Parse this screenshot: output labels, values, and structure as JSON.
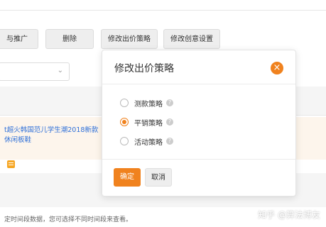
{
  "toolbar": {
    "promote_label": "与推广",
    "delete_label": "删除",
    "bid_strategy_label": "修改出价策略",
    "creative_label": "修改创意设置"
  },
  "table": {
    "product_title_line1": "t超火韩国范儿学生潮2018新款",
    "product_title_line2": "休闲板鞋",
    "footer_note": "定时间段数据，您可选择不同时间段来查看。"
  },
  "modal": {
    "title": "修改出价策略",
    "options": [
      {
        "label": "测款策略",
        "checked": false
      },
      {
        "label": "平销策略",
        "checked": true
      },
      {
        "label": "活动策略",
        "checked": false
      }
    ],
    "help_glyph": "?",
    "close_glyph": "×",
    "ok_label": "确定",
    "cancel_label": "取消"
  },
  "watermark": "知乎 @算法博友",
  "colors": {
    "accent": "#f0821e",
    "link": "#2f70d8"
  }
}
